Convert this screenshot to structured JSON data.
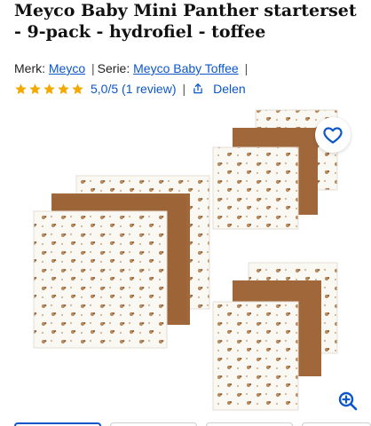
{
  "product": {
    "title": "Meyco Baby Mini Panther starterset - 9-pack - hydrofiel - toffee"
  },
  "meta": {
    "brand_label": "Merk:",
    "brand_link": "Meyco",
    "series_label": "Serie:",
    "series_link": "Meyco Baby Toffee",
    "separator": "|"
  },
  "rating": {
    "stars_filled": 5,
    "stars_total": 5,
    "text": "5,0/5 (1 review)",
    "star_color": "#f2a900"
  },
  "share": {
    "label": "Delen",
    "icon": "share-icon"
  },
  "gallery": {
    "favorite_icon": "heart-icon",
    "zoom_icon": "zoom-in-icon",
    "image_description_icon": "product-photo",
    "thumbnail_count_visible": 4
  },
  "colors": {
    "link": "#0b57c9",
    "toffee": "#a0673a",
    "cream": "#faf8f3",
    "dots": "#b88a5c"
  }
}
